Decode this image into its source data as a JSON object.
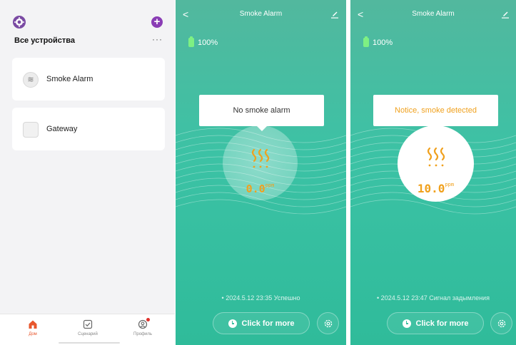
{
  "device_list": {
    "header_title": "Все устройства",
    "more_glyph": "···",
    "add_glyph": "+",
    "devices": [
      {
        "name": "Smoke Alarm",
        "icon": "smoke-sensor-icon",
        "glyph": "≋"
      },
      {
        "name": "Gateway",
        "icon": "gateway-icon",
        "glyph": ""
      }
    ],
    "tabs": [
      {
        "label": "Дом",
        "icon": "home-icon",
        "active": true
      },
      {
        "label": "Сценарий",
        "icon": "checkbox-icon",
        "active": false
      },
      {
        "label": "Профиль",
        "icon": "profile-icon",
        "active": false
      }
    ],
    "colors": {
      "brand": "#7a4aa3",
      "active_tab": "#e8572d",
      "badge": "#e0312b"
    }
  },
  "screens": [
    {
      "title": "Smoke Alarm",
      "back_glyph": "<",
      "battery": "100%",
      "notice": "No smoke alarm",
      "value": "0.0",
      "unit": "ppm",
      "status": "• 2024.5.12 23:35 Успешно",
      "more_label": "Click for more",
      "alarm": false
    },
    {
      "title": "Smoke Alarm",
      "back_glyph": "<",
      "battery": "100%",
      "notice": "Notice, smoke detected",
      "value": "10.0",
      "unit": "ppm",
      "status": "• 2024.5.12 23:47 Сигнал задымления",
      "more_label": "Click for more",
      "alarm": true
    }
  ],
  "colors": {
    "teal": "#3cc2a5",
    "gauge_accent": "#f0a11e",
    "alert_text": "#f0a11e",
    "battery": "#7ef083"
  }
}
